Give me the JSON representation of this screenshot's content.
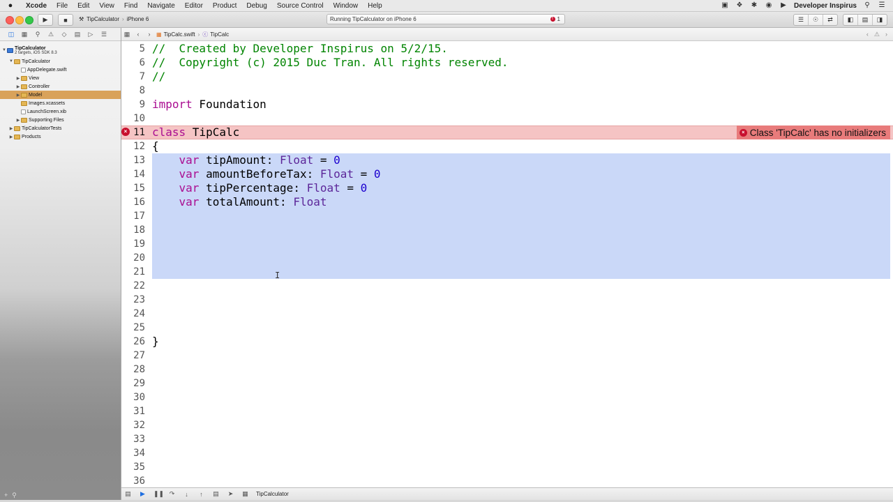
{
  "menubar": {
    "apple": "",
    "items": [
      "Xcode",
      "File",
      "Edit",
      "View",
      "Find",
      "Navigate",
      "Editor",
      "Product",
      "Debug",
      "Source Control",
      "Window",
      "Help"
    ],
    "user": "Developer Inspirus"
  },
  "toolbar": {
    "scheme": "TipCalculator",
    "device": "iPhone 6",
    "activity": "Running TipCalculator on iPhone 6",
    "error_count": "1"
  },
  "navigator": {
    "project": "TipCalculator",
    "project_sub": "2 targets, iOS SDK 8.3",
    "items": [
      {
        "label": "TipCalculator"
      },
      {
        "label": "AppDelegate.swift"
      },
      {
        "label": "View"
      },
      {
        "label": "Controller"
      },
      {
        "label": "Model"
      },
      {
        "label": "Images.xcassets"
      },
      {
        "label": "LaunchScreen.xib"
      },
      {
        "label": "Supporting Files"
      },
      {
        "label": "TipCalculatorTests"
      },
      {
        "label": "Products"
      }
    ]
  },
  "jumpbar": {
    "file": "TipCalc.swift",
    "symbol": "TipCalc"
  },
  "editor": {
    "lines": [
      {
        "n": "5",
        "text": "//  Created by Developer Inspirus on 5/2/15."
      },
      {
        "n": "6",
        "text": "//  Copyright (c) 2015 Duc Tran. All rights reserved."
      },
      {
        "n": "7",
        "text": "//"
      },
      {
        "n": "8",
        "text": ""
      },
      {
        "n": "9",
        "kw": "import",
        "rest": " Foundation"
      },
      {
        "n": "10",
        "text": ""
      },
      {
        "n": "11",
        "kw": "class",
        "rest": " TipCalc"
      },
      {
        "n": "12",
        "text": "{"
      },
      {
        "n": "13",
        "var": "tipAmount",
        "type": "Float",
        "num": "0"
      },
      {
        "n": "14",
        "var": "amountBeforeTax",
        "type": "Float",
        "num": "0"
      },
      {
        "n": "15",
        "var": "tipPercentage",
        "type": "Float",
        "num": "0"
      },
      {
        "n": "16",
        "var": "totalAmount",
        "type": "Float"
      },
      {
        "n": "17",
        "text": ""
      },
      {
        "n": "18",
        "text": ""
      },
      {
        "n": "19",
        "text": ""
      },
      {
        "n": "20",
        "text": ""
      },
      {
        "n": "21",
        "text": ""
      },
      {
        "n": "22",
        "text": ""
      },
      {
        "n": "23",
        "text": ""
      },
      {
        "n": "24",
        "text": ""
      },
      {
        "n": "25",
        "text": ""
      },
      {
        "n": "26",
        "text": "}"
      },
      {
        "n": "27",
        "text": ""
      },
      {
        "n": "28",
        "text": ""
      },
      {
        "n": "29",
        "text": ""
      },
      {
        "n": "30",
        "text": ""
      },
      {
        "n": "31",
        "text": ""
      },
      {
        "n": "32",
        "text": ""
      },
      {
        "n": "33",
        "text": ""
      },
      {
        "n": "34",
        "text": ""
      },
      {
        "n": "35",
        "text": ""
      },
      {
        "n": "36",
        "text": ""
      }
    ],
    "error_message": "Class 'TipCalc' has no initializers",
    "error_line": "11"
  },
  "debugbar": {
    "target": "TipCalculator"
  },
  "colors": {
    "comment": "#008400",
    "keyword": "#aa0d91",
    "type": "#5c2699",
    "number": "#1c00cf",
    "error": "#c8102e",
    "selection": "#cad8f8"
  }
}
